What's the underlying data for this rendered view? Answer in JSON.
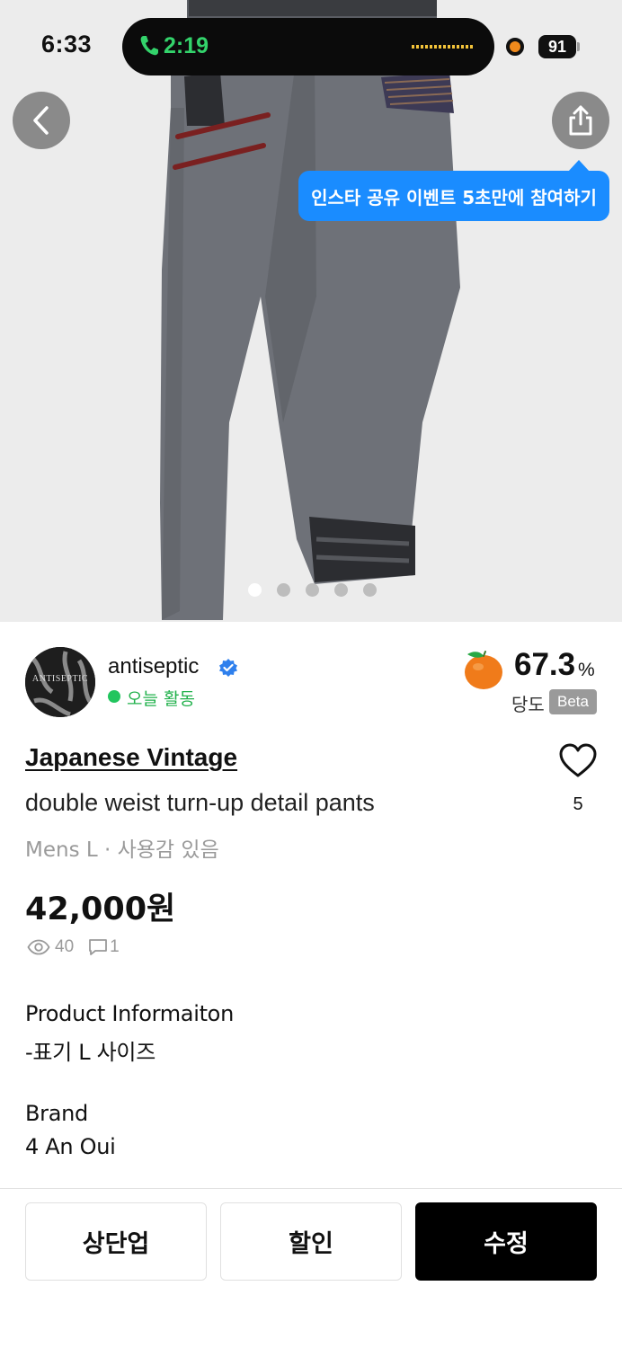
{
  "status_bar": {
    "time": "6:33",
    "call_time": "2:19",
    "battery": "91"
  },
  "share_tooltip": "인스타 공유 이벤트 5초만에 참여하기",
  "gallery": {
    "total_images": 5,
    "current_index": 1
  },
  "seller": {
    "name": "antiseptic",
    "avatar_text": "ANTISEPTIC",
    "activity": "오늘 활동",
    "score": "67.3",
    "score_unit": "%",
    "score_label": "당도",
    "score_badge": "Beta"
  },
  "product": {
    "brand": "Japanese Vintage",
    "title": "double weist turn-up detail pants",
    "meta": "Mens L · 사용감 있음",
    "likes": "5",
    "price": "42,000원",
    "views": "40",
    "comments": "1",
    "description": [
      "Product Informaiton",
      "-표기 L 사이즈",
      "",
      "Brand",
      "4 An Oui"
    ]
  },
  "actions": {
    "bump": "상단업",
    "discount": "할인",
    "edit": "수정"
  },
  "colors": {
    "accent_blue": "#1a8cff",
    "active_green": "#22c55e",
    "call_green": "#33d36b"
  }
}
